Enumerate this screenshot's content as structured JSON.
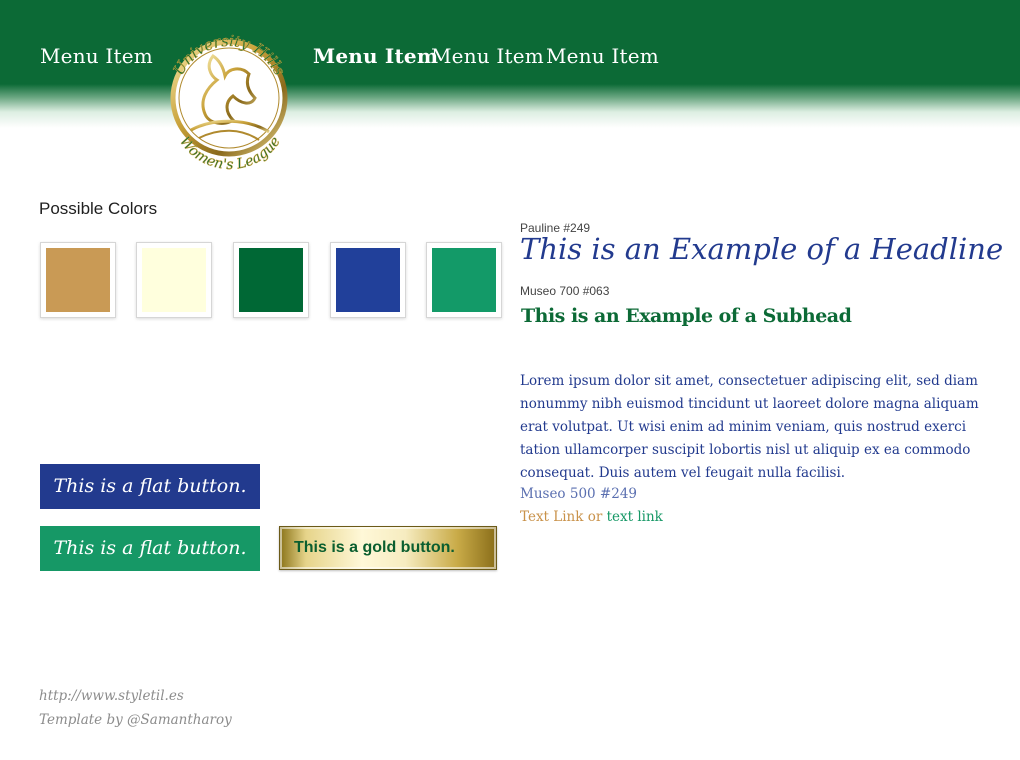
{
  "nav": {
    "items": [
      {
        "label": "Menu Item"
      },
      {
        "label": "Menu Item"
      },
      {
        "label": "Menu Item"
      },
      {
        "label": "Menu Item"
      }
    ]
  },
  "logo": {
    "text_top": "University Hills",
    "text_bottom": "Women's League"
  },
  "colors": {
    "title": "Possible Colors",
    "swatches": [
      "#c99a55",
      "#ffffdd",
      "#006835",
      "#21409a",
      "#139a68"
    ]
  },
  "typography": {
    "headline_label": "Pauline #249",
    "headline": "This is an Example of a Headline",
    "subhead_label": "Museo 700 #063",
    "subhead": "This is an Example of a Subhead",
    "body": "Lorem ipsum dolor sit amet, consectetuer adipiscing elit, sed diam nonummy nibh euismod tincidunt ut laoreet dolore magna aliquam erat volutpat. Ut wisi enim ad minim veniam, quis nostrud exerci tation ullamcorper suscipit lobortis nisl ut aliquip ex ea commodo consequat. Duis autem vel feugait nulla facilisi.",
    "body_font_note": "Museo 500 #249",
    "link_gold": "Text Link",
    "link_or": " or ",
    "link_green": "text link"
  },
  "buttons": {
    "flat_blue": "This is a flat button.",
    "flat_green": "This is a flat button.",
    "gold": "This is a gold button."
  },
  "footer": {
    "url": "http://www.styletil.es",
    "credit": "Template by @Samantharoy"
  }
}
